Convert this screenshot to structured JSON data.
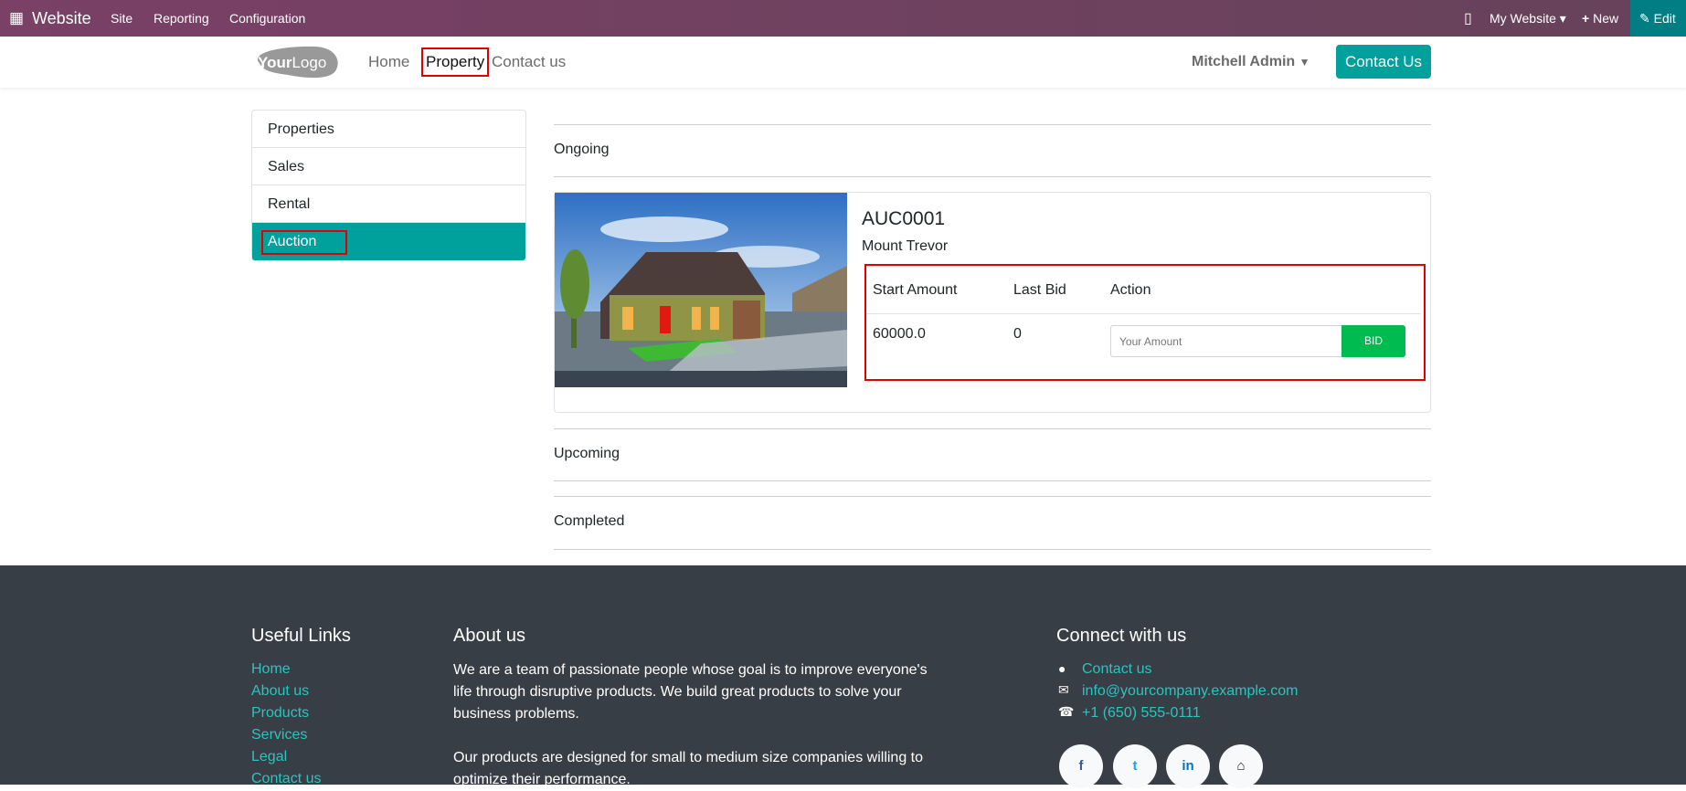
{
  "topbar": {
    "app": "Website",
    "menu": [
      "Site",
      "Reporting",
      "Configuration"
    ],
    "my_website": "My Website",
    "new": "New",
    "edit": "Edit"
  },
  "header": {
    "logo": "YourLogo",
    "nav": [
      "Home",
      "Property",
      "Contact us"
    ],
    "user": "Mitchell Admin",
    "contact_button": "Contact Us"
  },
  "sidebar": {
    "items": [
      "Properties",
      "Sales",
      "Rental",
      "Auction"
    ]
  },
  "main": {
    "sections": [
      "Ongoing",
      "Upcoming",
      "Completed"
    ],
    "auction": {
      "code": "AUC0001",
      "name": "Mount Trevor",
      "headers": [
        "Start Amount",
        "Last Bid",
        "Action"
      ],
      "start_amount": "60000.0",
      "last_bid": "0",
      "amount_placeholder": "Your Amount",
      "bid_label": "BID"
    }
  },
  "footer": {
    "useful_links_title": "Useful Links",
    "links": [
      "Home",
      "About us",
      "Products",
      "Services",
      "Legal",
      "Contact us"
    ],
    "about_title": "About us",
    "about_p1": "We are a team of passionate people whose goal is to improve everyone's life through disruptive products. We build great products to solve your business problems.",
    "about_p2": "Our products are designed for small to medium size companies willing to optimize their performance.",
    "connect_title": "Connect with us",
    "contact": "Contact us",
    "email": "info@yourcompany.example.com",
    "phone": "+1 (650) 555-0111",
    "social": [
      "f",
      "t",
      "in",
      "home"
    ]
  },
  "colors": {
    "accent": "#00a09d",
    "bid": "#00bb4f",
    "topbar": "#7a4066",
    "footer": "#383e45"
  }
}
